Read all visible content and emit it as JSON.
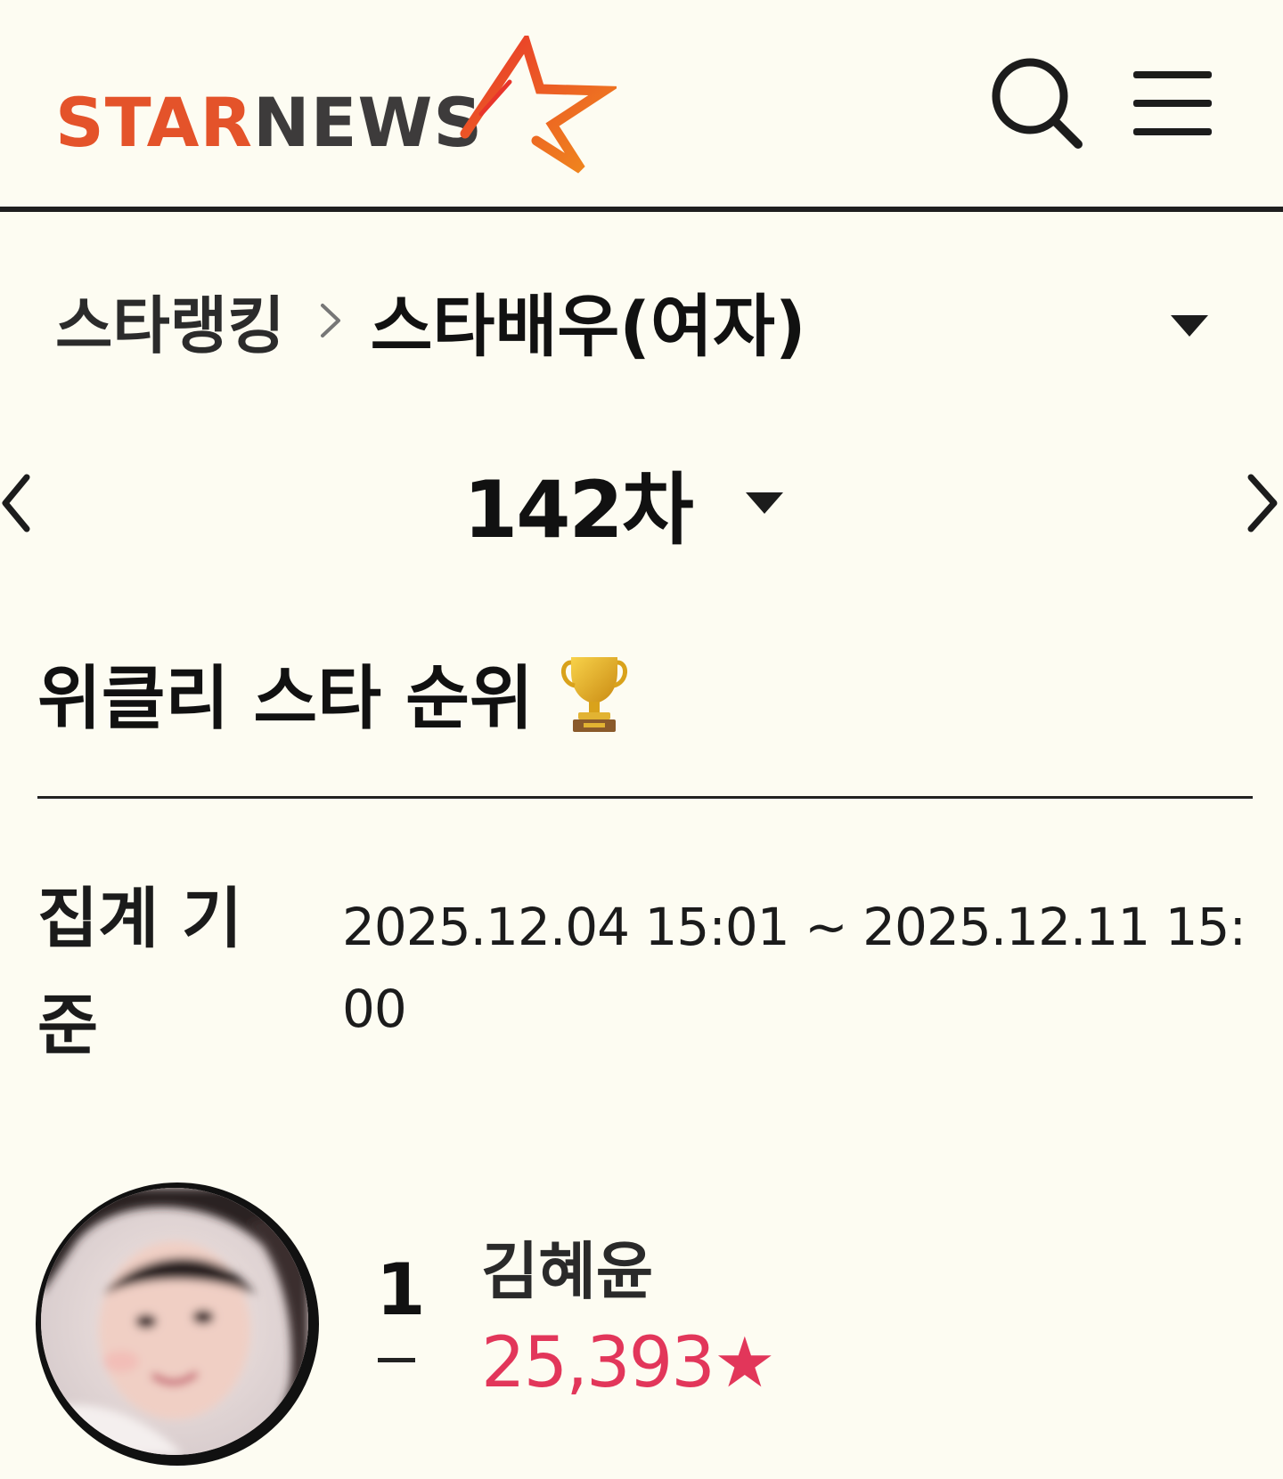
{
  "header": {
    "logo_star": "STAR",
    "logo_news": "NEWS",
    "brand_color": "#e4532a",
    "search_icon": "search-icon",
    "menu_icon": "hamburger-menu-icon"
  },
  "breadcrumb": {
    "root": "스타랭킹",
    "separator_icon": "chevron-right-icon",
    "current": "스타배우(여자)",
    "dropdown_icon": "caret-down-icon"
  },
  "round": {
    "label": "142차",
    "prev_icon": "chevron-left-icon",
    "next_icon": "chevron-right-icon",
    "dropdown_icon": "caret-down-icon"
  },
  "weekly": {
    "title": "위클리 스타 순위",
    "title_icon": "trophy-icon",
    "period_label": "집계 기준",
    "period_value": "2025.12.04 15:01 ~ 2025.12.11 15:00"
  },
  "ranking": [
    {
      "rank": "1",
      "change": "–",
      "name": "김혜윤",
      "score": "25,393★",
      "score_color": "#e2365a"
    }
  ]
}
